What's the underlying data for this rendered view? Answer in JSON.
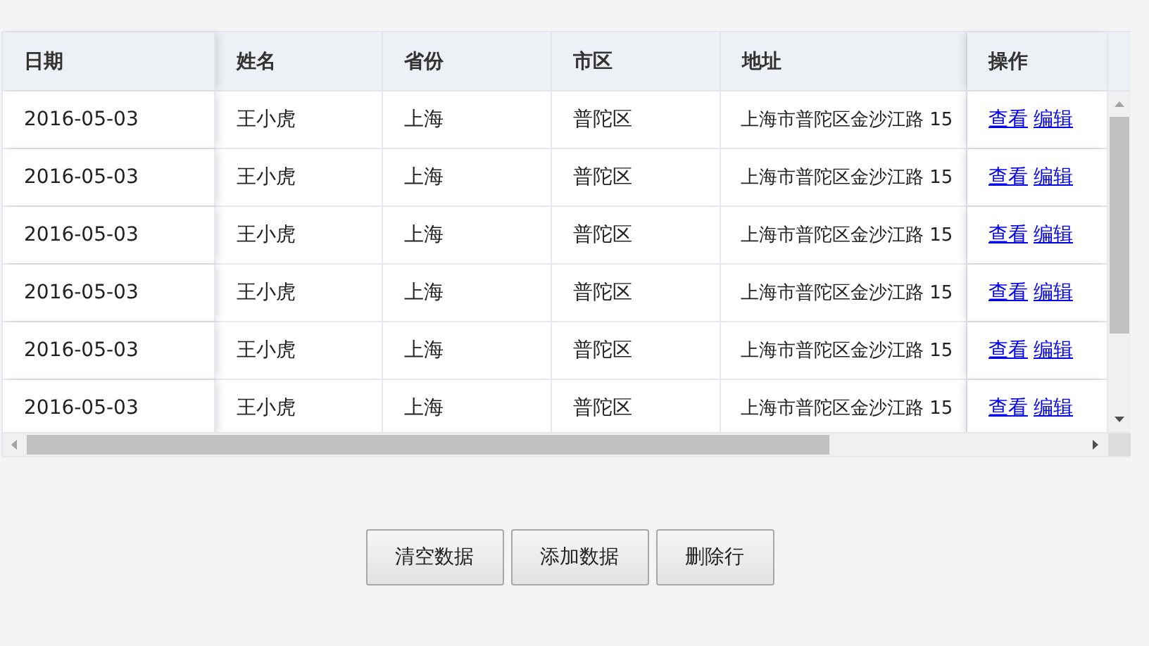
{
  "table": {
    "columns": [
      "日期",
      "姓名",
      "省份",
      "市区",
      "地址",
      "操作"
    ],
    "rows": [
      {
        "date": "2016-05-03",
        "name": "王小虎",
        "province": "上海",
        "city": "普陀区",
        "address": "上海市普陀区金沙江路 15",
        "actions": [
          "查看",
          "编辑"
        ]
      },
      {
        "date": "2016-05-03",
        "name": "王小虎",
        "province": "上海",
        "city": "普陀区",
        "address": "上海市普陀区金沙江路 15",
        "actions": [
          "查看",
          "编辑"
        ]
      },
      {
        "date": "2016-05-03",
        "name": "王小虎",
        "province": "上海",
        "city": "普陀区",
        "address": "上海市普陀区金沙江路 15",
        "actions": [
          "查看",
          "编辑"
        ]
      },
      {
        "date": "2016-05-03",
        "name": "王小虎",
        "province": "上海",
        "city": "普陀区",
        "address": "上海市普陀区金沙江路 15",
        "actions": [
          "查看",
          "编辑"
        ]
      },
      {
        "date": "2016-05-03",
        "name": "王小虎",
        "province": "上海",
        "city": "普陀区",
        "address": "上海市普陀区金沙江路 15",
        "actions": [
          "查看",
          "编辑"
        ]
      },
      {
        "date": "2016-05-03",
        "name": "王小虎",
        "province": "上海",
        "city": "普陀区",
        "address": "上海市普陀区金沙江路 15",
        "actions": [
          "查看",
          "编辑"
        ]
      }
    ]
  },
  "buttons": [
    "清空数据",
    "添加数据",
    "删除行"
  ]
}
